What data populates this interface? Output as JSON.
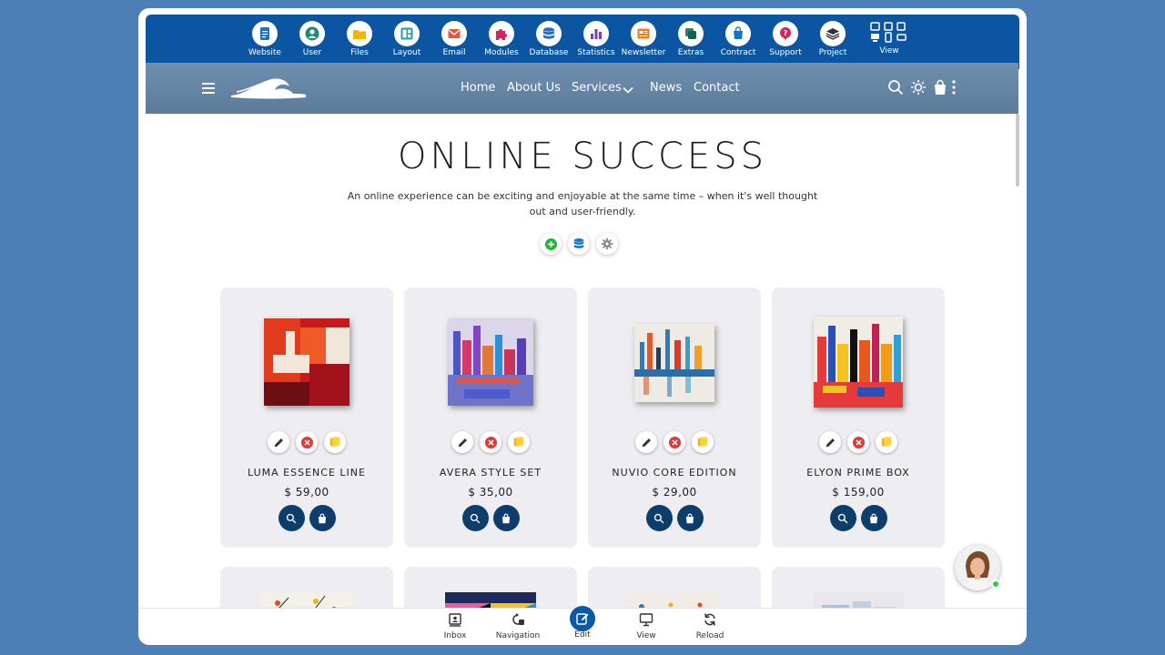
{
  "admin_toolbar": {
    "items": [
      {
        "label": "Website",
        "icon": "document-icon",
        "color": "#1a73c9"
      },
      {
        "label": "User",
        "icon": "user-icon",
        "color": "#1f8a70"
      },
      {
        "label": "Files",
        "icon": "folder-icon",
        "color": "#f4b400"
      },
      {
        "label": "Layout",
        "icon": "layout-icon",
        "color": "#17a2a8"
      },
      {
        "label": "Email",
        "icon": "mail-icon",
        "color": "#e5533d"
      },
      {
        "label": "Modules",
        "icon": "puzzle-icon",
        "color": "#d6245a"
      },
      {
        "label": "Database",
        "icon": "database-icon",
        "color": "#1a73c9"
      },
      {
        "label": "Statistics",
        "icon": "chart-icon",
        "color": "#7b3fb5"
      },
      {
        "label": "Newsletter",
        "icon": "newsletter-icon",
        "color": "#f07d1a"
      },
      {
        "label": "Extras",
        "icon": "extras-icon",
        "color": "#1f8a70"
      },
      {
        "label": "Contract",
        "icon": "contract-icon",
        "color": "#1a73c9"
      },
      {
        "label": "Support",
        "icon": "support-icon",
        "color": "#d6245a"
      },
      {
        "label": "Project",
        "icon": "layers-icon",
        "color": "#ffffff"
      },
      {
        "label": "View",
        "icon": "devices-icon",
        "color": "#ffffff"
      }
    ]
  },
  "site_nav": {
    "links": [
      "Home",
      "About Us",
      "Services",
      "News",
      "Contact"
    ]
  },
  "hero": {
    "title": "ONLINE SUCCESS",
    "subtitle": "An online experience can be exciting and enjoyable at the same time – when it's well thought out and user-friendly."
  },
  "products": [
    {
      "name": "LUMA ESSENCE LINE",
      "price": "$ 59,00"
    },
    {
      "name": "AVERA STYLE SET",
      "price": "$ 35,00"
    },
    {
      "name": "NUVIO CORE EDITION",
      "price": "$ 29,00"
    },
    {
      "name": "ELYON PRIME BOX",
      "price": "$ 159,00"
    }
  ],
  "bottom_bar": {
    "items": [
      "Inbox",
      "Navigation",
      "Edit",
      "View",
      "Reload"
    ]
  }
}
